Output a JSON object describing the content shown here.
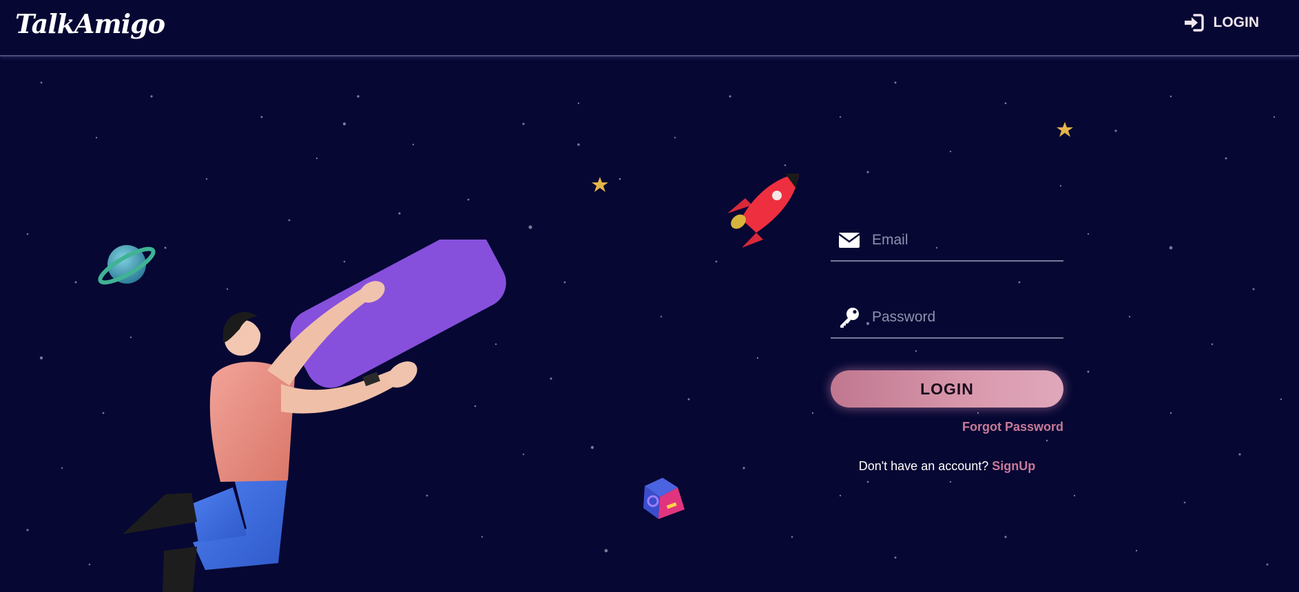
{
  "app": {
    "logo_text": "TalkAmigo"
  },
  "header": {
    "login_label": "LOGIN"
  },
  "form": {
    "email_placeholder": "Email",
    "password_placeholder": "Password",
    "login_button": "LOGIN",
    "forgot_password": "Forgot Password",
    "signup_prompt": "Don't have an account?",
    "signup_link": "SignUp"
  },
  "colors": {
    "background": "#060733",
    "accent_pink": "#c87a97",
    "button_gradient_start": "#c0778f",
    "button_gradient_end": "#e0a7bb"
  },
  "icons": {
    "nav_login": "sign-in-icon",
    "email": "envelope-icon",
    "password": "key-icon"
  }
}
